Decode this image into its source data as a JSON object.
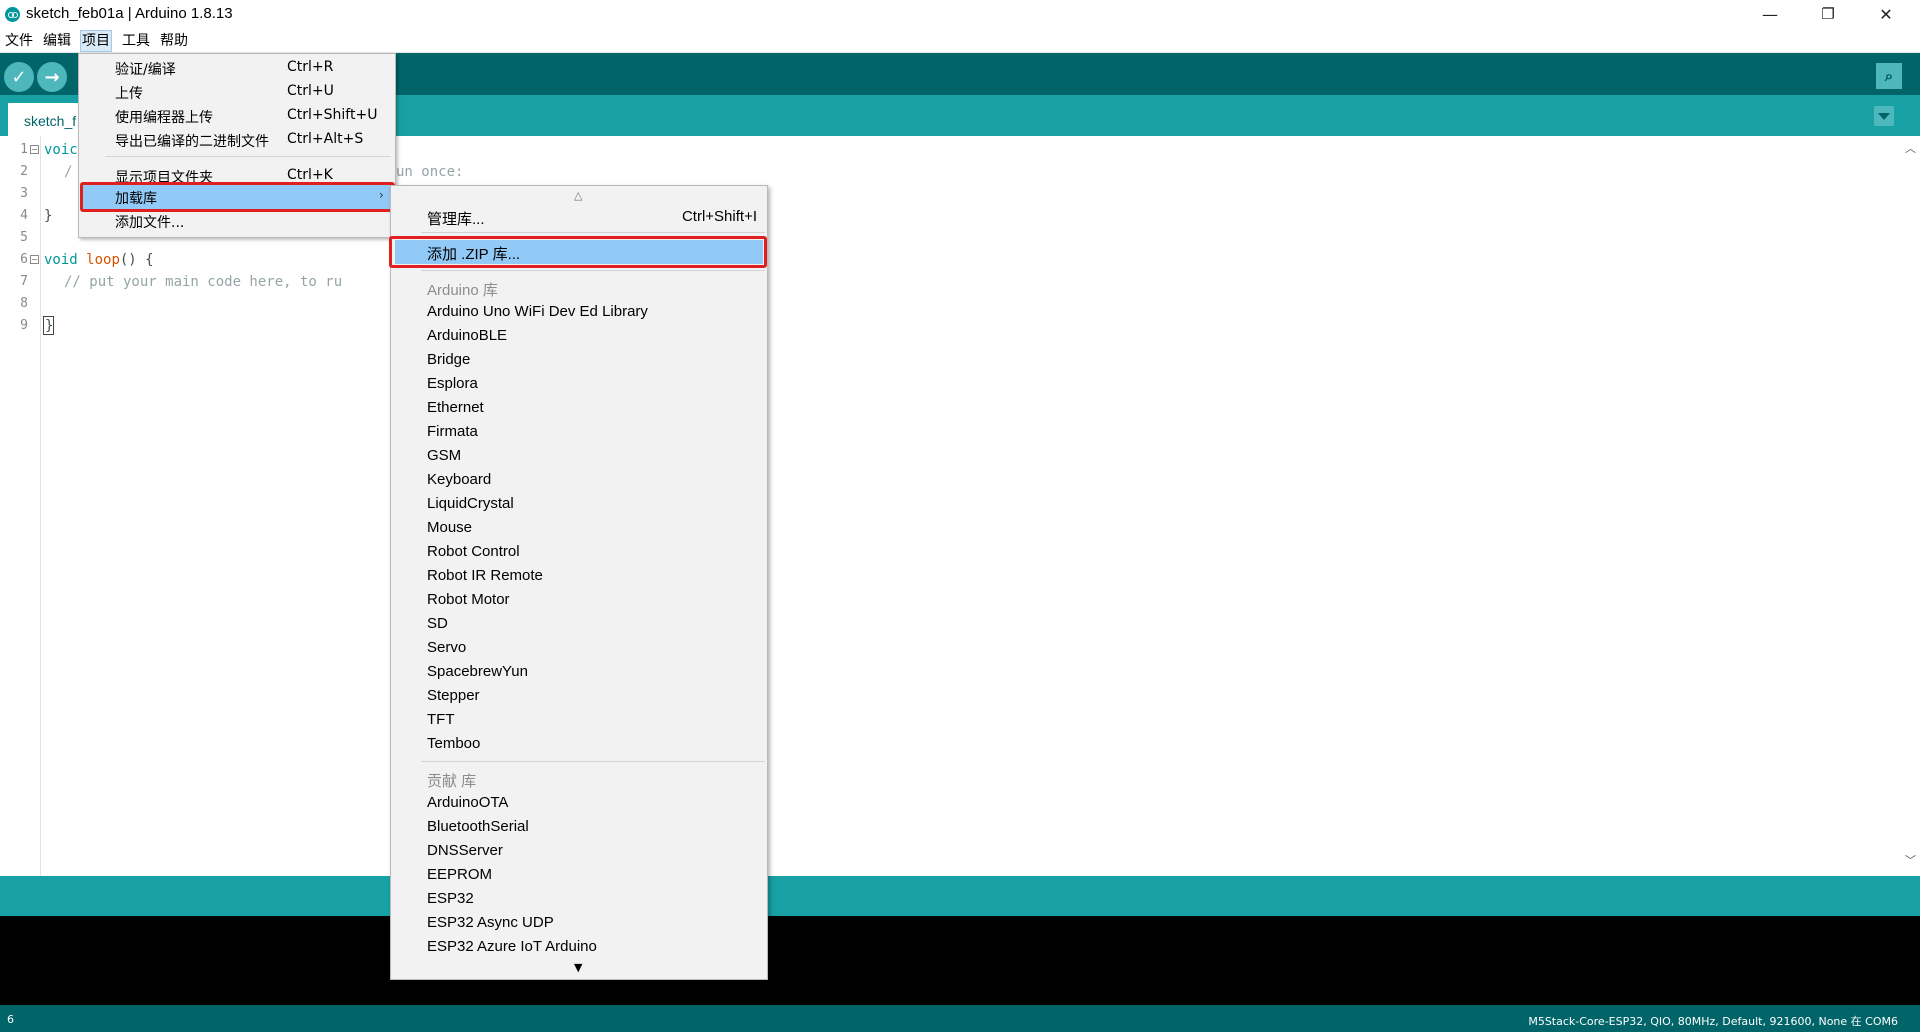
{
  "window": {
    "title": "sketch_feb01a | Arduino 1.8.13",
    "minimize": "—",
    "maximize": "❐",
    "close": "✕"
  },
  "menubar": {
    "items": [
      "文件",
      "编辑",
      "项目",
      "工具",
      "帮助"
    ],
    "active": "项目"
  },
  "toolbar": {
    "verify_icon": "✓",
    "upload_icon": "→",
    "serial_icon": "⌕"
  },
  "tab": {
    "label": "sketch_f"
  },
  "editor": {
    "line_numbers": [
      "1",
      "2",
      "3",
      "4",
      "5",
      "6",
      "7",
      "8",
      "9"
    ],
    "line1": "voic",
    "line2a": "/",
    "line2b": "un once:",
    "line4": "}",
    "line6_kw": "void",
    "line6_fn": "loop",
    "line6_rest": "() {",
    "line7": "// put your main code here, to ru",
    "line9": "}"
  },
  "project_menu": {
    "items": [
      {
        "label": "验证/编译",
        "accel": "Ctrl+R"
      },
      {
        "label": "上传",
        "accel": "Ctrl+U"
      },
      {
        "label": "使用编程器上传",
        "accel": "Ctrl+Shift+U"
      },
      {
        "label": "导出已编译的二进制文件",
        "accel": "Ctrl+Alt+S"
      },
      {
        "label": "显示项目文件夹",
        "accel": "Ctrl+K"
      },
      {
        "label": "加载库",
        "accel": ""
      },
      {
        "label": "添加文件...",
        "accel": ""
      }
    ],
    "submenu_arrow": "›"
  },
  "library_menu": {
    "scroll_up": "△",
    "scroll_down": "▼",
    "manage_label": "管理库...",
    "manage_accel": "Ctrl+Shift+I",
    "add_zip_label": "添加 .ZIP 库...",
    "arduino_header": "Arduino 库",
    "arduino_libs": [
      "Arduino Uno WiFi Dev Ed Library",
      "ArduinoBLE",
      "Bridge",
      "Esplora",
      "Ethernet",
      "Firmata",
      "GSM",
      "Keyboard",
      "LiquidCrystal",
      "Mouse",
      "Robot Control",
      "Robot IR Remote",
      "Robot Motor",
      "SD",
      "Servo",
      "SpacebrewYun",
      "Stepper",
      "TFT",
      "Temboo"
    ],
    "contrib_header": "贡献 库",
    "contrib_libs": [
      "ArduinoOTA",
      "BluetoothSerial",
      "DNSServer",
      "EEPROM",
      "ESP32",
      "ESP32 Async UDP",
      "ESP32 Azure IoT Arduino"
    ]
  },
  "status": {
    "line": "6",
    "board": "M5Stack-Core-ESP32, QIO, 80MHz, Default, 921600, None 在 COM6"
  },
  "colors": {
    "toolbar": "#006468",
    "tabstrip": "#17a1a5",
    "highlight": "#91c9f7",
    "annotation_red": "#e02020"
  }
}
